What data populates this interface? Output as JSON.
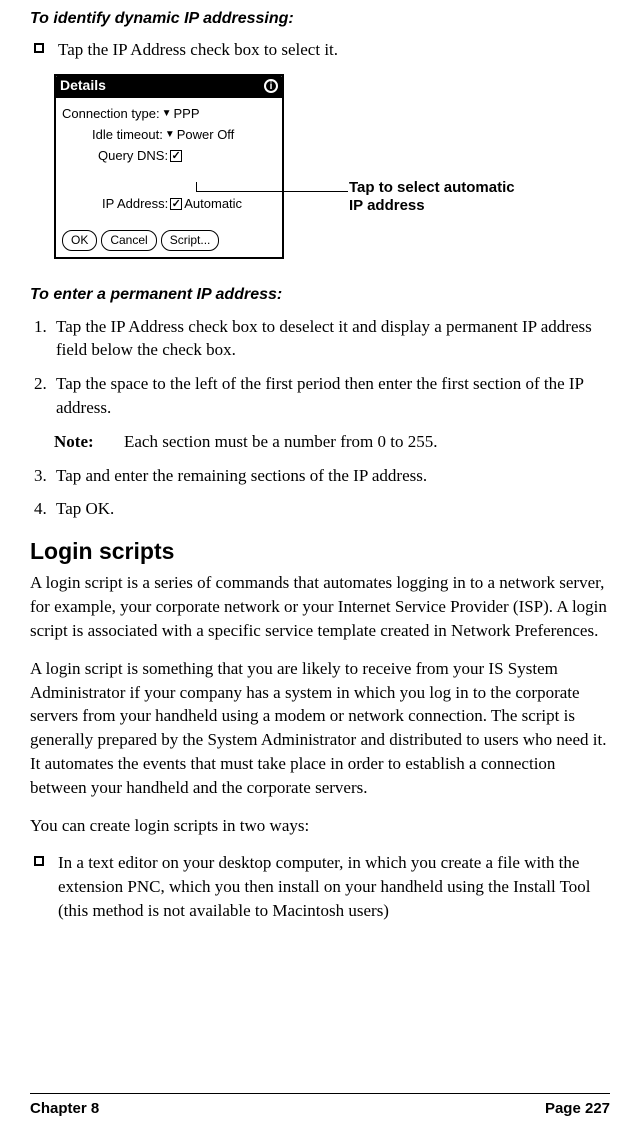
{
  "headings": {
    "dynamic": "To identify dynamic IP addressing:",
    "permanent": "To enter a permanent IP address:",
    "login_scripts": "Login scripts"
  },
  "bullets": {
    "dynamic_tap": "Tap the IP Address check box to select it.",
    "text_editor": "In a text editor on your desktop computer, in which you create a file with the extension PNC, which you then install on your handheld using the Install Tool (this method is not available to Macintosh users)"
  },
  "palm": {
    "title": "Details",
    "conn_label": "Connection type:",
    "conn_value": "PPP",
    "idle_label": "Idle timeout:",
    "idle_value": "Power Off",
    "dns_label": "Query DNS:",
    "ip_label": "IP Address:",
    "ip_value": "Automatic",
    "btn_ok": "OK",
    "btn_cancel": "Cancel",
    "btn_script": "Script..."
  },
  "callout": {
    "line1": "Tap to select automatic",
    "line2": "IP address"
  },
  "steps": {
    "s1": "Tap the IP Address check box to deselect it and display a permanent IP address field below the check box.",
    "s2": "Tap the space to the left of the first period then enter the first section of the IP address.",
    "note_label": "Note:",
    "note_text": "Each section must be a number from 0 to 255.",
    "s3": "Tap and enter the remaining sections of the IP address.",
    "s4": "Tap OK.",
    "n1": "1.",
    "n2": "2.",
    "n3": "3.",
    "n4": "4."
  },
  "paragraphs": {
    "p1": "A login script is a series of commands that automates logging in to a network server, for example, your corporate network or your Internet Service Provider (ISP). A login script is associated with a specific service template created in Network Preferences.",
    "p2": "A login script is something that you are likely to receive from your IS System Administrator if your company has a system in which you log in to the corporate servers from your handheld using a modem or network connection. The script is generally prepared by the System Administrator and distributed to users who need it. It automates the events that must take place in order to establish a connection between your handheld and the corporate servers.",
    "p3": "You can create login scripts in two ways:"
  },
  "footer": {
    "chapter": "Chapter 8",
    "page": "Page 227"
  }
}
